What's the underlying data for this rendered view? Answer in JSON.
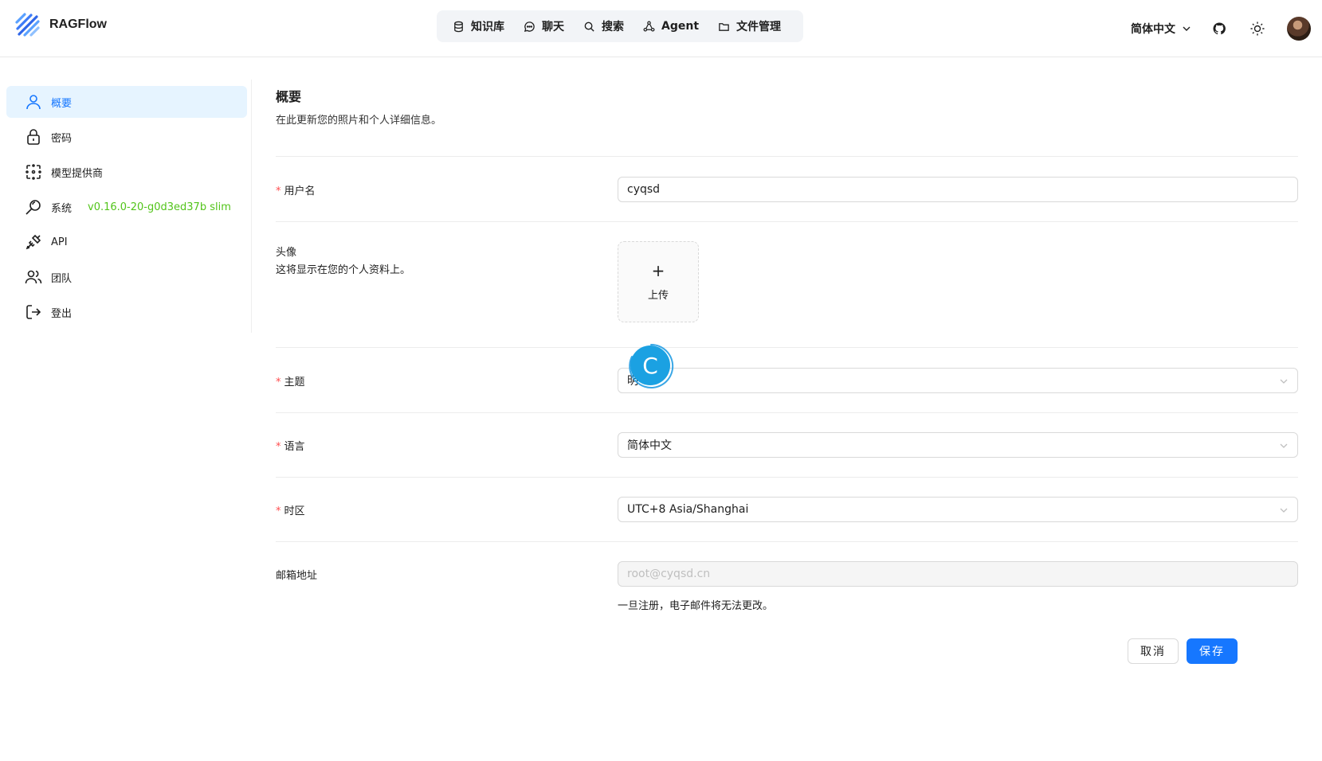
{
  "app": {
    "name": "RAGFlow"
  },
  "nav": {
    "items": [
      {
        "label": "知识库",
        "icon": "database-icon"
      },
      {
        "label": "聊天",
        "icon": "chat-icon"
      },
      {
        "label": "搜索",
        "icon": "search-icon"
      },
      {
        "label": "Agent",
        "icon": "agent-icon"
      },
      {
        "label": "文件管理",
        "icon": "folder-icon"
      }
    ]
  },
  "header": {
    "language": "简体中文"
  },
  "sidebar": {
    "items": [
      {
        "label": "概要",
        "icon": "user-icon",
        "active": true
      },
      {
        "label": "密码",
        "icon": "lock-icon"
      },
      {
        "label": "模型提供商",
        "icon": "model-provider-icon"
      },
      {
        "label": "系统",
        "icon": "system-search-icon",
        "version": "v0.16.0-20-g0d3ed37b slim"
      },
      {
        "label": "API",
        "icon": "api-plug-icon"
      },
      {
        "label": "团队",
        "icon": "team-icon"
      },
      {
        "label": "登出",
        "icon": "logout-icon"
      }
    ]
  },
  "profile": {
    "title": "概要",
    "subtitle": "在此更新您的照片和个人详细信息。",
    "username": {
      "label": "用户名",
      "value": "cyqsd"
    },
    "avatar": {
      "label": "头像",
      "desc": "这将显示在您的个人资料上。",
      "plus": "+",
      "upload": "上传"
    },
    "theme": {
      "label": "主题",
      "value": "明"
    },
    "language": {
      "label": "语言",
      "value": "简体中文"
    },
    "timezone": {
      "label": "时区",
      "value": "UTC+8 Asia/Shanghai"
    },
    "email": {
      "label": "邮箱地址",
      "value": "root@cyqsd.cn",
      "hint": "一旦注册，电子邮件将无法更改。"
    },
    "required_mark": "*",
    "cancel_label": "取消",
    "save_label": "保存"
  },
  "overlay": {
    "letter": "C"
  },
  "colors": {
    "accent": "#1677ff",
    "version": "#52c41a",
    "required": "#ff4d4f",
    "active_bg": "#e6f4ff"
  }
}
